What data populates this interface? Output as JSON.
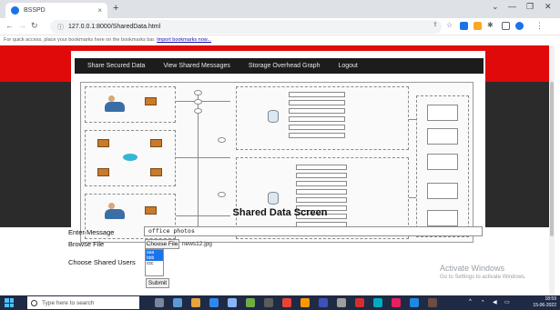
{
  "browser": {
    "tab_title": "BSSPD",
    "tab_close": "×",
    "new_tab": "+",
    "url": "127.0.0.1:8000/SharedData.html",
    "bookmarks_prompt": "For quick access, place your bookmarks here on the bookmarks bar.",
    "bookmarks_link": "Import bookmarks now..."
  },
  "nav": {
    "items": [
      {
        "label": "Share Secured Data"
      },
      {
        "label": "View Shared Messages"
      },
      {
        "label": "Storage Overhead Graph"
      },
      {
        "label": "Logout"
      }
    ]
  },
  "page": {
    "heading": "Shared Data Screen",
    "form": {
      "message_label": "Enter Message",
      "message_value": "office photos",
      "file_label": "Browse File",
      "file_button": "Choose File",
      "file_name": "news12.jpg",
      "users_label": "Choose Shared Users",
      "user_options": [
        "aaa",
        "bbb",
        "ccc"
      ],
      "submit_label": "Submit"
    }
  },
  "watermark": {
    "line1": "Activate Windows",
    "line2": "Go to Settings to activate Windows."
  },
  "taskbar": {
    "search_placeholder": "Type here to search",
    "time": "18:59",
    "date": "15-06-2022"
  },
  "colors": {
    "header_red": "#e10a0a",
    "menu_bg": "#1c1c1c",
    "dark_band": "#2b2b2b",
    "taskbar": "#1f2a44"
  }
}
